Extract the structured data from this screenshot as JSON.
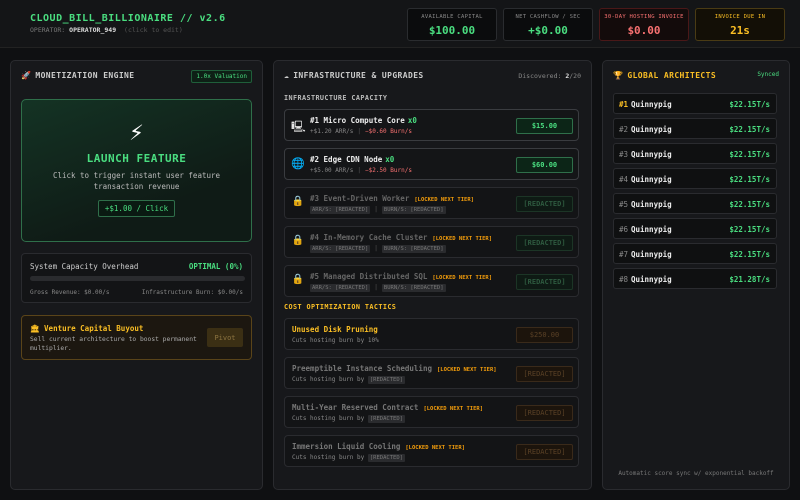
{
  "header": {
    "title": "CLOUD_BILL_BILLIONAIRE // v2.6",
    "operator_label": "OPERATOR:",
    "operator_name": "OPERATOR_949",
    "operator_hint": "(click to edit)"
  },
  "stats": {
    "capital": {
      "label": "AVAILABLE CAPITAL",
      "value": "$100.00"
    },
    "cashflow": {
      "label": "NET CASHFLOW / SEC",
      "value": "+$0.00"
    },
    "invoice": {
      "label": "30-DAY HOSTING INVOICE",
      "value": "$0.00"
    },
    "due": {
      "label": "INVOICE DUE IN",
      "value": "21s"
    }
  },
  "monetization": {
    "icon": "rocket-icon",
    "title": "MONETIZATION ENGINE",
    "valuation": "1.0x Valuation",
    "launch": {
      "icon": "lightning-icon",
      "glyph": "⚡",
      "title": "LAUNCH FEATURE",
      "desc": "Click to trigger instant user feature transaction revenue",
      "button": "+$1.00 / Click"
    },
    "capacity": {
      "label": "System Capacity Overhead",
      "status": "OPTIMAL (0%)",
      "load_fraction": 0,
      "gross": "Gross Revenue: $0.00/s",
      "burn": "Infrastructure Burn: $0.00/s"
    },
    "vc": {
      "icon": "bank-icon",
      "title": "Venture Capital Buyout",
      "desc": "Sell current architecture to boost permanent multiplier.",
      "button": "Pivot"
    }
  },
  "infra": {
    "icon": "cloud-icon",
    "title": "INFRASTRUCTURE & UPGRADES",
    "discovered_label": "Discovered:",
    "discovered_count": "2",
    "discovered_total": "/20",
    "capacity_title": "INFRASTRUCTURE CAPACITY",
    "cost_title": "COST OPTIMIZATION TACTICS",
    "items": [
      {
        "icon": "server-icon",
        "name": "#1 Micro Compute Core",
        "level": "x0",
        "arr": "+$1.20 ARR/s",
        "burn": "−$0.60 Burn/s",
        "price": "$15.00"
      },
      {
        "icon": "globe-icon",
        "name": "#2 Edge CDN Node",
        "level": "x0",
        "arr": "+$5.00 ARR/s",
        "burn": "−$2.50 Burn/s",
        "price": "$60.00"
      },
      {
        "icon": "lock-icon",
        "name": "#3 Event-Driven Worker",
        "tag": "[LOCKED NEXT TIER]",
        "arr": "ARR/S: [REDACTED]",
        "burn": "BURN/S: [REDACTED]",
        "price": "[REDACTED]"
      },
      {
        "icon": "lock-icon",
        "name": "#4 In-Memory Cache Cluster",
        "tag": "[LOCKED NEXT TIER]",
        "arr": "ARR/S: [REDACTED]",
        "burn": "BURN/S: [REDACTED]",
        "price": "[REDACTED]"
      },
      {
        "icon": "lock-icon",
        "name": "#5 Managed Distributed SQL",
        "tag": "[LOCKED NEXT TIER]",
        "arr": "ARR/S: [REDACTED]",
        "burn": "BURN/S: [REDACTED]",
        "price": "[REDACTED]"
      }
    ],
    "tactics": [
      {
        "name": "Unused Disk Pruning",
        "desc": "Cuts hosting burn by 10%",
        "price": "$250.00"
      },
      {
        "name": "Preemptible Instance Scheduling",
        "tag": "[LOCKED NEXT TIER]",
        "desc": "Cuts hosting burn by",
        "redacted": "[REDACTED]",
        "price": "[REDACTED]"
      },
      {
        "name": "Multi-Year Reserved Contract",
        "tag": "[LOCKED NEXT TIER]",
        "desc": "Cuts hosting burn by",
        "redacted": "[REDACTED]",
        "price": "[REDACTED]"
      },
      {
        "name": "Immersion Liquid Cooling",
        "tag": "[LOCKED NEXT TIER]",
        "desc": "Cuts hosting burn by",
        "redacted": "[REDACTED]",
        "price": "[REDACTED]"
      }
    ]
  },
  "leaderboard": {
    "icon": "trophy-icon",
    "title": "GLOBAL ARCHITECTS",
    "status": "Synced",
    "rows": [
      {
        "rank": "#1",
        "name": "Quinnypig",
        "score": "$22.15T/s"
      },
      {
        "rank": "#2",
        "name": "Quinnypig",
        "score": "$22.15T/s"
      },
      {
        "rank": "#3",
        "name": "Quinnypig",
        "score": "$22.15T/s"
      },
      {
        "rank": "#4",
        "name": "Quinnypig",
        "score": "$22.15T/s"
      },
      {
        "rank": "#5",
        "name": "Quinnypig",
        "score": "$22.15T/s"
      },
      {
        "rank": "#6",
        "name": "Quinnypig",
        "score": "$22.15T/s"
      },
      {
        "rank": "#7",
        "name": "Quinnypig",
        "score": "$22.15T/s"
      },
      {
        "rank": "#8",
        "name": "Quinnypig",
        "score": "$21.28T/s"
      }
    ],
    "footer": "Automatic score sync w/ exponential backoff"
  }
}
